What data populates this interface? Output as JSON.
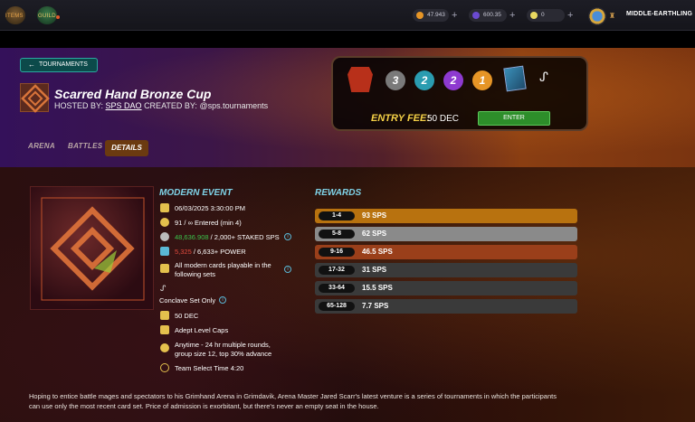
{
  "topbar": {
    "items_label": "ITEMS",
    "guild_label": "GUILD",
    "balance_1": "47.943",
    "balance_2": "600.35",
    "balance_3": "0",
    "plus": "+",
    "username": "MIDDLE-EARTHLING",
    "accent": "#e9a54a"
  },
  "header": {
    "back_label": "TOURNAMENTS",
    "title": "Scarred Hand Bronze Cup",
    "hosted_prefix": "HOSTED BY:",
    "host": "SPS DAO",
    "created_prefix": "CREATED BY:",
    "creator": "@sps.tournaments"
  },
  "entry": {
    "badges": [
      "3",
      "2",
      "2",
      "1"
    ],
    "badge_colors": [
      "#7a7a7a",
      "#2a9cb0",
      "#8e3ad0",
      "#e69526"
    ],
    "fee_label": "ENTRY FEE:",
    "fee_value": "50 DEC",
    "enter_label": "ENTER"
  },
  "tabs": {
    "arena": "ARENA",
    "battles": "BATTLES",
    "details": "DETAILS"
  },
  "event": {
    "heading": "MODERN EVENT",
    "start": "06/03/2025 3:30:00 PM",
    "entered": "91 / ∞ Entered (min 4)",
    "staked_value": "48,636.908",
    "staked_req": "/ 2,000+ STAKED SPS",
    "power_value": "5,325",
    "power_req": "/ 6,633+ POWER",
    "sets_line1": "All modern cards playable in the",
    "sets_line2": "following sets",
    "conclave": "Conclave Set Only",
    "fee": "50 DEC",
    "caps": "Adept Level Caps",
    "format_line1": "Anytime - 24 hr multiple rounds,",
    "format_line2": "group size 12, top 30% advance",
    "team_select": "Team Select Time 4:20"
  },
  "rewards": {
    "heading": "REWARDS",
    "rows": [
      {
        "rank": "1-4",
        "amount": "93 SPS",
        "color": "#b8720f"
      },
      {
        "rank": "5-8",
        "amount": "62 SPS",
        "color": "#8a8a8a"
      },
      {
        "rank": "9-16",
        "amount": "46.5 SPS",
        "color": "#9a3f1a"
      },
      {
        "rank": "17-32",
        "amount": "31 SPS",
        "color": "#3a3a3a"
      },
      {
        "rank": "33-64",
        "amount": "15.5 SPS",
        "color": "#3a3a3a"
      },
      {
        "rank": "65-128",
        "amount": "7.7 SPS",
        "color": "#3a3a3a"
      }
    ]
  },
  "story": "Hoping to entice battle mages and spectators to his Grimhand Arena in Grimdavik, Arena Master Jared Scarr's latest venture is a series of tournaments in which the participants can use only the most recent card set. Price of admission is exorbitant, but there's never an empty seat in the house."
}
